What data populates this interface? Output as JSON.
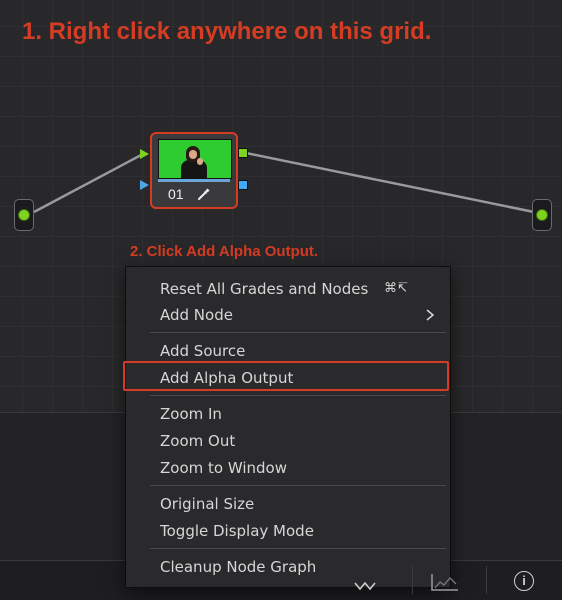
{
  "annotations": {
    "step1": "1. Right click anywhere on this grid.",
    "step2": "2. Click Add Alpha Output."
  },
  "node": {
    "label": "01"
  },
  "context_menu": {
    "groups": [
      [
        {
          "label": "Reset All Grades and Nodes",
          "shortcut": "⌘↸",
          "submenu": false
        },
        {
          "label": "Add Node",
          "shortcut": "",
          "submenu": true
        }
      ],
      [
        {
          "label": "Add Source"
        },
        {
          "label": "Add Alpha Output",
          "highlighted": true
        }
      ],
      [
        {
          "label": "Zoom In"
        },
        {
          "label": "Zoom Out"
        },
        {
          "label": "Zoom to Window"
        }
      ],
      [
        {
          "label": "Original Size"
        },
        {
          "label": "Toggle Display Mode"
        }
      ],
      [
        {
          "label": "Cleanup Node Graph"
        }
      ]
    ]
  },
  "colors": {
    "accent_red": "#d63c23",
    "port_green": "#7ed321",
    "port_blue": "#3fa9f5",
    "menu_bg": "#2a2a2d"
  },
  "icons": {
    "node_tool": "eyedropper-icon",
    "bottom_bar": [
      "keyframe-icon",
      "scope-icon",
      "info-icon"
    ]
  },
  "bottom_bar": {
    "info_glyph": "i"
  }
}
